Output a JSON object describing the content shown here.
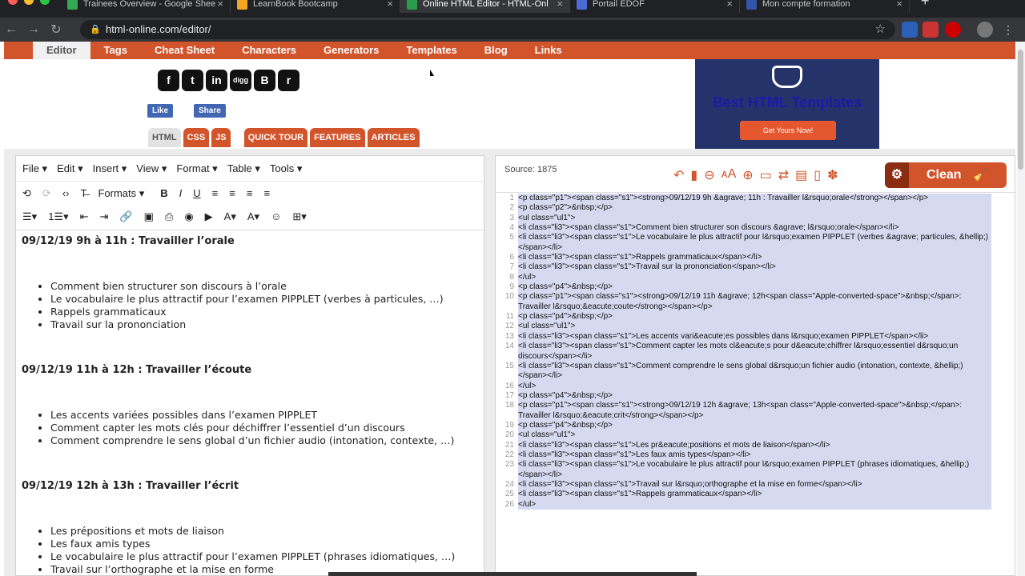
{
  "browser": {
    "tabs": [
      {
        "title": "Trainees Overview - Google Shee",
        "color": "#34a853"
      },
      {
        "title": "LearnBook Bootcamp",
        "color": "#f4a623"
      },
      {
        "title": "Online HTML Editor - HTML-Onl",
        "color": "#2a9d4a"
      },
      {
        "title": "Portail EDOF",
        "color": "#4a6cd4"
      },
      {
        "title": "Mon compte formation",
        "color": "#3355aa"
      }
    ],
    "url": "html-online.com/editor/",
    "traffic_colors": [
      "#ff5f57",
      "#febc2e",
      "#28c840"
    ]
  },
  "site_nav": {
    "items": [
      "Editor",
      "Tags",
      "Cheat Sheet",
      "Characters",
      "Generators",
      "Templates",
      "Blog",
      "Links"
    ]
  },
  "social": {
    "icons": [
      "f",
      "t",
      "in",
      "digg",
      "B",
      "r"
    ],
    "like": "Like",
    "share": "Share"
  },
  "editor_tabs": [
    "HTML",
    "CSS",
    "JS",
    "QUICK TOUR",
    "FEATURES",
    "ARTICLES"
  ],
  "ad": {
    "title": "Best HTML Templates",
    "button": "Get Yours Now!"
  },
  "editor": {
    "menus": [
      "File ▾",
      "Edit ▾",
      "Insert ▾",
      "View ▾",
      "Format ▾",
      "Table ▾",
      "Tools ▾"
    ],
    "formats": "Formats ▾",
    "sections": [
      {
        "heading": "09/12/19 9h à 11h : Travailler l’orale",
        "items": [
          "Comment bien structurer son discours à l’orale",
          "Le vocabulaire le plus attractif pour l’examen PIPPLET (verbes à particules, …)",
          "Rappels grammaticaux",
          "Travail sur la prononciation"
        ]
      },
      {
        "heading": "09/12/19 11h à 12h  : Travailler l’écoute",
        "items": [
          "Les accents variées possibles dans l’examen PIPPLET",
          "Comment capter les mots clés pour déchiffrer l’essentiel d’un discours",
          "Comment comprendre le sens global d’un fichier audio (intonation, contexte, …)"
        ]
      },
      {
        "heading": "09/12/19 12h à 13h  : Travailler l’écrit",
        "items": [
          "Les prépositions et mots de liaison",
          "Les faux amis types",
          "Le vocabulaire le plus attractif pour l’examen PIPPLET (phrases idiomatiques, …)",
          "Travail sur l’orthographe et la mise en forme"
        ]
      }
    ]
  },
  "source": {
    "label": "Source: 1875",
    "clean_label": "Clean",
    "lines": [
      "<p class=\"p1\"><span class=\"s1\"><strong>09/12/19 9h &agrave; 11h : Travailler l&rsquo;orale</strong></span></p>",
      "<p class=\"p2\">&nbsp;</p>",
      "<ul class=\"ul1\">",
      "<li class=\"li3\"><span class=\"s1\">Comment bien structurer son discours &agrave; l&rsquo;orale</span></li>",
      "<li class=\"li3\"><span class=\"s1\">Le vocabulaire le plus attractif pour l&rsquo;examen PIPPLET (verbes &agrave; particules, &hellip;)</span></li>",
      "<li class=\"li3\"><span class=\"s1\">Rappels grammaticaux</span></li>",
      "<li class=\"li3\"><span class=\"s1\">Travail sur la prononciation</span></li>",
      "</ul>",
      "<p class=\"p4\">&nbsp;</p>",
      "<p class=\"p1\"><span class=\"s1\"><strong>09/12/19 11h &agrave; 12h<span class=\"Apple-converted-space\">&nbsp;</span>: Travailler l&rsquo;&eacute;coute</strong></span></p>",
      "<p class=\"p4\">&nbsp;</p>",
      "<ul class=\"ul1\">",
      "<li class=\"li3\"><span class=\"s1\">Les accents vari&eacute;es possibles dans l&rsquo;examen PIPPLET</span></li>",
      "<li class=\"li3\"><span class=\"s1\">Comment capter les mots cl&eacute;s pour d&eacute;chiffrer l&rsquo;essentiel d&rsquo;un discours</span></li>",
      "<li class=\"li3\"><span class=\"s1\">Comment comprendre le sens global d&rsquo;un fichier audio (intonation, contexte, &hellip;)</span></li>",
      "</ul>",
      "<p class=\"p4\">&nbsp;</p>",
      "<p class=\"p1\"><span class=\"s1\"><strong>09/12/19 12h &agrave; 13h<span class=\"Apple-converted-space\">&nbsp;</span>: Travailler l&rsquo;&eacute;crit</strong></span></p>",
      "<p class=\"p4\">&nbsp;</p>",
      "<ul class=\"ul1\">",
      "<li class=\"li3\"><span class=\"s1\">Les pr&eacute;positions et mots de liaison</span></li>",
      "<li class=\"li3\"><span class=\"s1\">Les faux amis types</span></li>",
      "<li class=\"li3\"><span class=\"s1\">Le vocabulaire le plus attractif pour l&rsquo;examen PIPPLET (phrases idiomatiques, &hellip;)</span></li>",
      "<li class=\"li3\"><span class=\"s1\">Travail sur l&rsquo;orthographe et la mise en forme</span></li>",
      "<li class=\"li3\"><span class=\"s1\">Rappels grammaticaux</span></li>",
      "</ul>"
    ]
  },
  "colors": {
    "accent": "#d2542b",
    "selection": "#d6daf0",
    "ad_bg": "#24346b"
  }
}
